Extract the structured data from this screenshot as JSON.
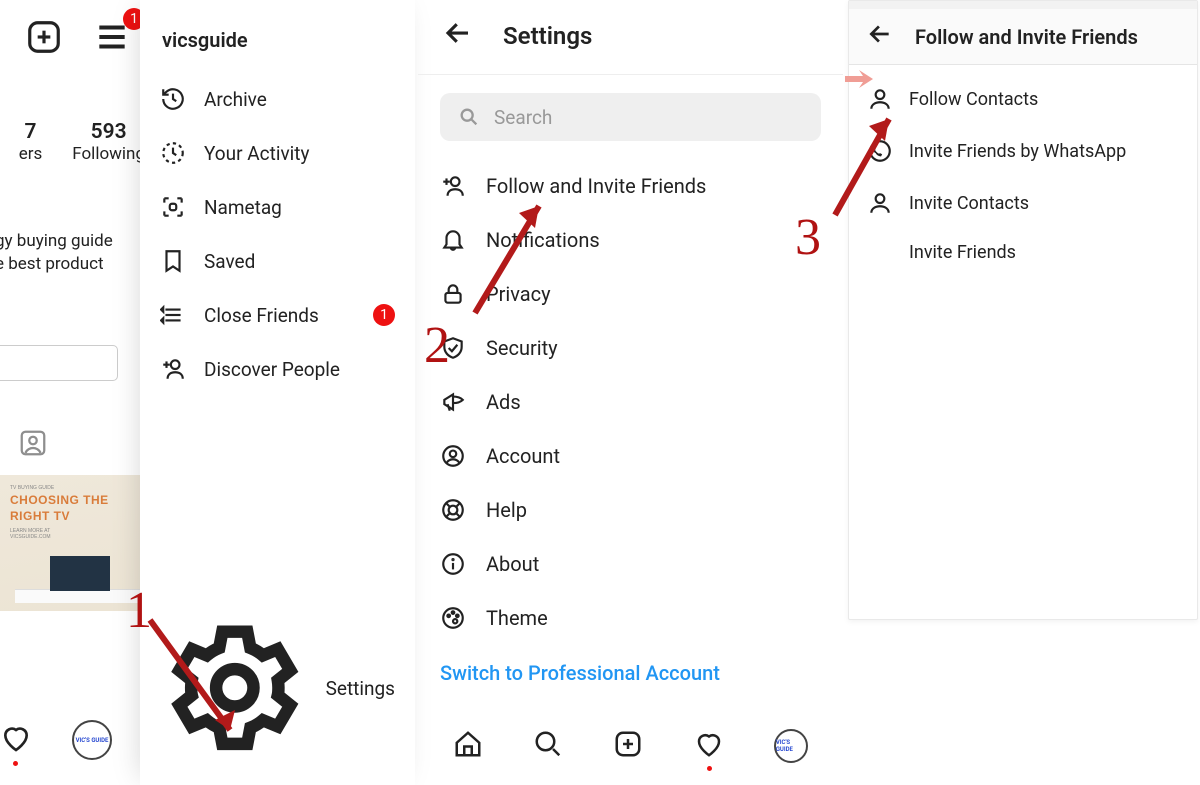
{
  "panel1": {
    "badge": "1",
    "stats": {
      "num7": "7",
      "numFollowing": "593",
      "lblFollowers": "ers",
      "lblFollowing": "Following"
    },
    "bio1": "gy buying guide",
    "bio2": "e best product",
    "thumb": {
      "small": "TV BUYING GUIDE",
      "big1": "CHOOSING THE",
      "big2": "RIGHT TV",
      "learn": "LEARN MORE AT",
      "site": "VICSGUIDE.COM"
    },
    "avatar_text": "VIC'S GUIDE"
  },
  "drawer": {
    "title": "vicsguide",
    "items": [
      {
        "label": "Archive"
      },
      {
        "label": "Your Activity"
      },
      {
        "label": "Nametag"
      },
      {
        "label": "Saved"
      },
      {
        "label": "Close Friends",
        "badge": "1"
      },
      {
        "label": "Discover People"
      }
    ],
    "settings": "Settings"
  },
  "settings": {
    "title": "Settings",
    "search_placeholder": "Search",
    "items": [
      "Follow and Invite Friends",
      "Notifications",
      "Privacy",
      "Security",
      "Ads",
      "Account",
      "Help",
      "About",
      "Theme"
    ],
    "pro_link": "Switch to Professional Account",
    "avatar_text": "VIC'S GUIDE"
  },
  "follow_invite": {
    "title": "Follow and Invite Friends",
    "items": [
      "Follow Contacts",
      "Invite Friends by WhatsApp",
      "Invite Contacts",
      "Invite Friends"
    ]
  },
  "steps": {
    "s1": "1",
    "s2": "2",
    "s3": "3"
  }
}
